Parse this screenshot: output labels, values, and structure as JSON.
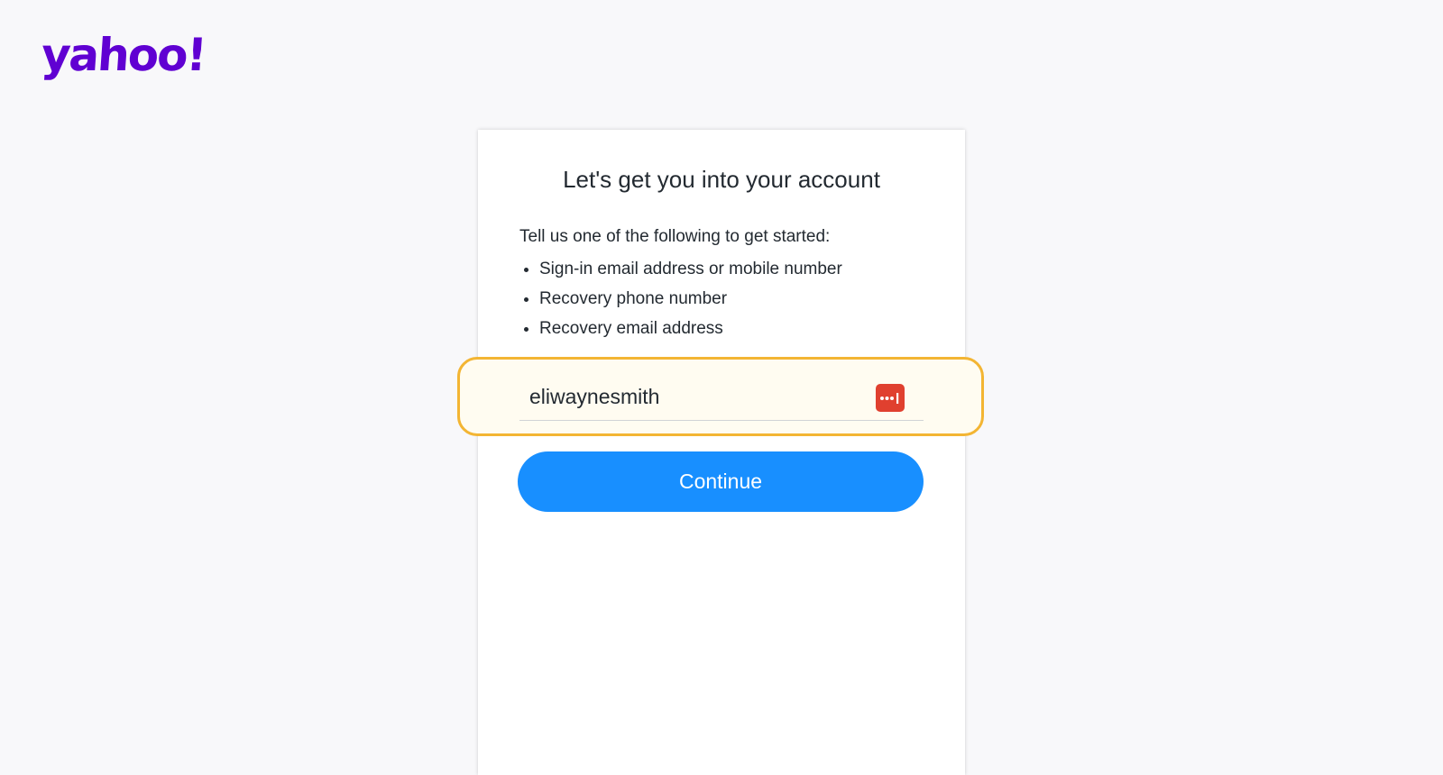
{
  "brand": {
    "logo_text": "yahoo!",
    "color": "#6001d2"
  },
  "card": {
    "title": "Let's get you into your account",
    "intro": "Tell us one of the following to get started:",
    "options": [
      "Sign-in email address or mobile number",
      "Recovery phone number",
      "Recovery email address"
    ]
  },
  "form": {
    "username_value": "eliwaynesmith",
    "password_manager_icon": "password-dots-icon",
    "continue_label": "Continue",
    "continue_color": "#188fff",
    "highlight_color": "#f3b533"
  }
}
